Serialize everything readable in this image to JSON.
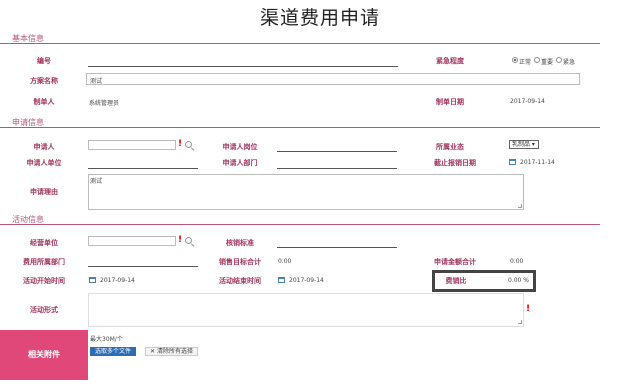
{
  "page": {
    "title": "渠道费用申请"
  },
  "sections": {
    "basic": "基本信息",
    "apply": "申请信息",
    "activity": "活动信息"
  },
  "basic": {
    "number_label": "编号",
    "urgency_label": "紧急程度",
    "urgency_options": [
      "正常",
      "重要",
      "紧急"
    ],
    "plan_name_label": "方案名称",
    "plan_name_value": "测试",
    "creator_label": "制单人",
    "creator_value": "系统管理员",
    "create_date_label": "制单日期",
    "create_date_value": "2017-09-14"
  },
  "apply": {
    "applicant_label": "申请人",
    "position_label": "申请人岗位",
    "business_label": "所属业态",
    "business_value": "乳制品",
    "unit_label": "申请人单位",
    "dept_label": "申请人部门",
    "deadline_label": "截止报销日期",
    "deadline_value": "2017-11-14",
    "reason_label": "申请理由",
    "reason_value": "测试"
  },
  "activity": {
    "dealer_label": "经营单位",
    "standard_label": "核销标准",
    "cost_dept_label": "费用所属部门",
    "sales_target_label": "销售目标合计",
    "sales_target_value": "0.00",
    "amount_total_label": "申请金额合计",
    "amount_total_value": "0.00",
    "start_label": "活动开始时间",
    "start_value": "2017-09-14",
    "end_label": "活动结束时间",
    "end_value": "2017-09-14",
    "ratio_label": "费销比",
    "ratio_value": "0.00 %",
    "form_label": "活动形式"
  },
  "attachment": {
    "label": "相关附件",
    "max_size": "最大30M/个",
    "select_button": "选取多个文件",
    "clear_button": "清除所有选择"
  },
  "required_mark": "!"
}
